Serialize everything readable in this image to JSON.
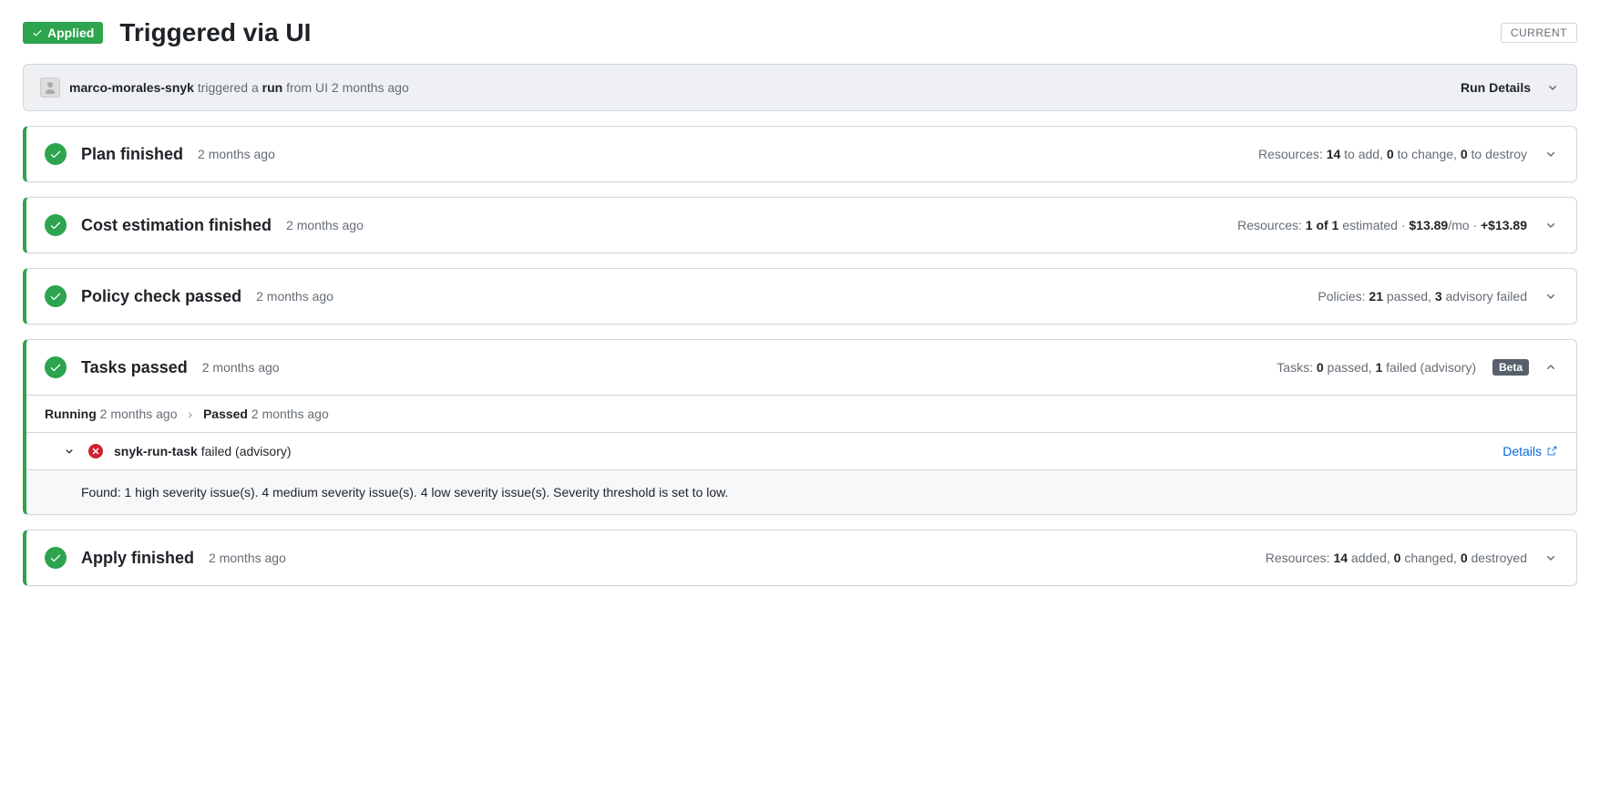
{
  "header": {
    "applied_label": "Applied",
    "title": "Triggered via UI",
    "current_label": "CURRENT"
  },
  "trigger": {
    "user": "marco-morales-snyk",
    "action_prefix": " triggered a ",
    "run_word": "run",
    "action_suffix": " from UI 2 months ago",
    "run_details_label": "Run Details"
  },
  "stages": {
    "plan": {
      "title": "Plan finished",
      "time": "2 months ago",
      "summary_prefix": "Resources: ",
      "to_add": "14",
      "to_add_suffix": " to add, ",
      "to_change": "0",
      "to_change_suffix": " to change, ",
      "to_destroy": "0",
      "to_destroy_suffix": " to destroy"
    },
    "cost": {
      "title": "Cost estimation finished",
      "time": "2 months ago",
      "summary_prefix": "Resources: ",
      "estimated": "1 of 1",
      "estimated_suffix": " estimated · ",
      "monthly": "$13.89",
      "monthly_suffix": "/mo · ",
      "delta": "+$13.89"
    },
    "policy": {
      "title": "Policy check passed",
      "time": "2 months ago",
      "summary_prefix": "Policies: ",
      "passed": "21",
      "passed_suffix": " passed, ",
      "advisory": "3",
      "advisory_suffix": " advisory failed"
    },
    "tasks": {
      "title": "Tasks passed",
      "time": "2 months ago",
      "summary_prefix": "Tasks: ",
      "passed": "0",
      "passed_suffix": " passed, ",
      "failed": "1",
      "failed_suffix": " failed (advisory)",
      "beta_label": "Beta",
      "breadcrumb": {
        "running_label": "Running",
        "running_time": " 2 months ago",
        "passed_label": "Passed",
        "passed_time": " 2 months ago"
      },
      "task": {
        "name": "snyk-run-task",
        "status": " failed (advisory)",
        "details_label": "Details",
        "message": "Found: 1 high severity issue(s). 4 medium severity issue(s). 4 low severity issue(s). Severity threshold is set to low."
      }
    },
    "apply": {
      "title": "Apply finished",
      "time": "2 months ago",
      "summary_prefix": "Resources: ",
      "added": "14",
      "added_suffix": " added, ",
      "changed": "0",
      "changed_suffix": " changed, ",
      "destroyed": "0",
      "destroyed_suffix": " destroyed"
    }
  }
}
